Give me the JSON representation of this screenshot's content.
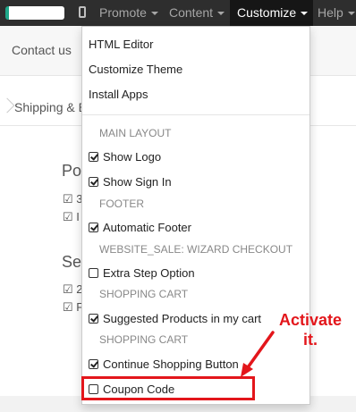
{
  "navbar": {
    "items": [
      {
        "label": "Promote"
      },
      {
        "label": "Content"
      },
      {
        "label": "Customize"
      },
      {
        "label": "Help"
      }
    ]
  },
  "page": {
    "contact": "Contact us",
    "wizard_step": "Shipping & B",
    "section1": {
      "title": "Po",
      "lines": [
        "☑ 3",
        "☑ I"
      ]
    },
    "section2": {
      "title": "Se",
      "lines": [
        "☑ 2",
        "☑ F"
      ]
    }
  },
  "menu": {
    "html_editor": "HTML Editor",
    "customize_theme": "Customize Theme",
    "install_apps": "Install Apps",
    "main_layout_header": "MAIN LAYOUT",
    "show_logo": "Show Logo",
    "show_sign_in": "Show Sign In",
    "footer_header": "FOOTER",
    "automatic_footer": "Automatic Footer",
    "wizard_header": "WEBSITE_SALE: WIZARD CHECKOUT",
    "extra_step": "Extra Step Option",
    "cart_header_1": "SHOPPING CART",
    "suggested_products": "Suggested Products in my cart",
    "cart_header_2": "SHOPPING CART",
    "continue_shopping": "Continue Shopping Button",
    "coupon_code": "Coupon Code"
  },
  "checkboxes": {
    "show_logo": true,
    "show_sign_in": true,
    "automatic_footer": true,
    "extra_step": false,
    "suggested_products": true,
    "continue_shopping": true,
    "coupon_code": false
  },
  "callout": {
    "line1": "Activate",
    "line2": "it."
  },
  "colors": {
    "navbar": "#2e2e2e",
    "highlight": "#e3161b"
  }
}
